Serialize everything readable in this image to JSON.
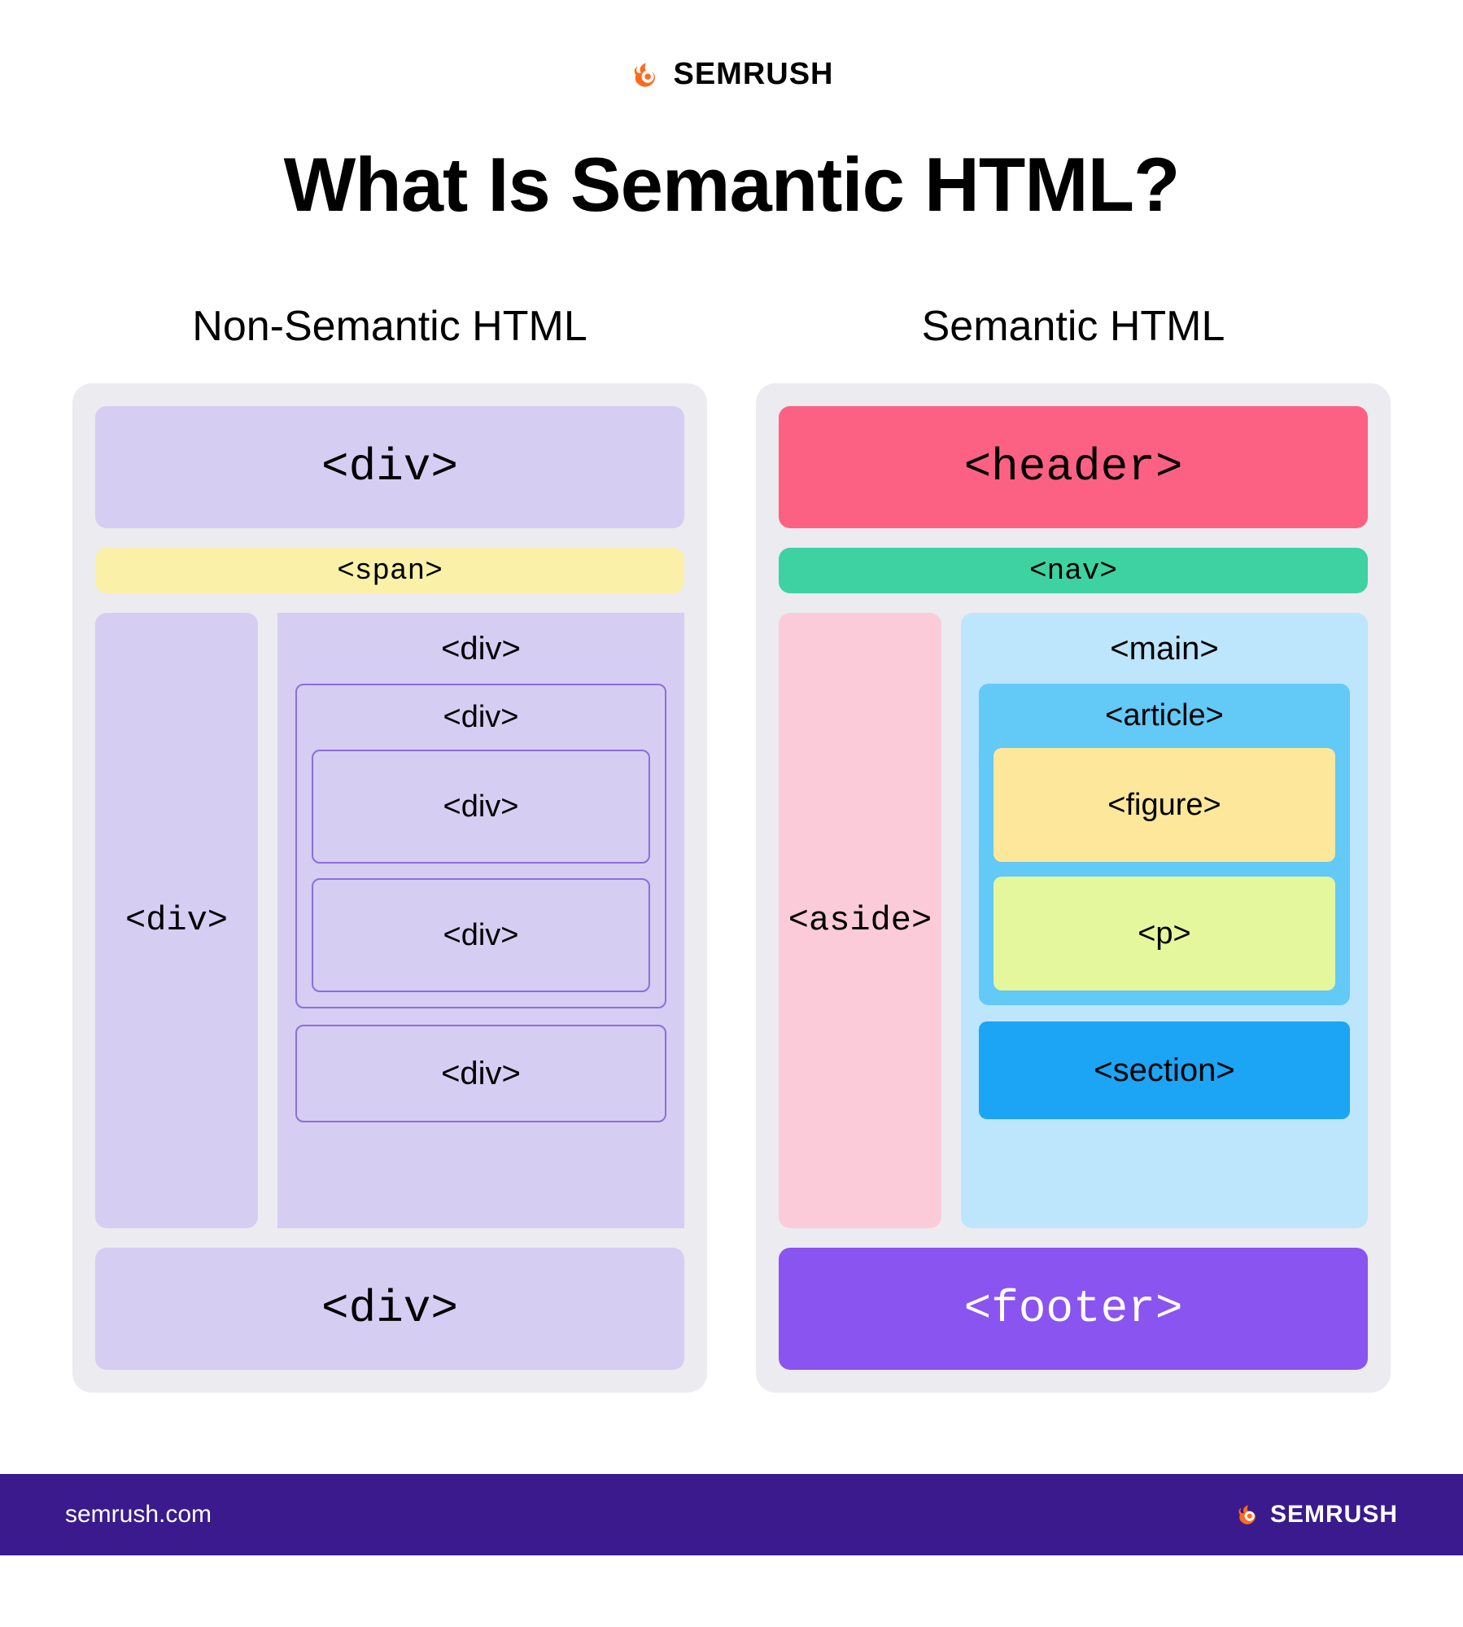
{
  "brand": {
    "name": "SEMRUSH",
    "url": "semrush.com"
  },
  "title": "What Is Semantic HTML?",
  "left": {
    "heading": "Non-Semantic HTML",
    "header": "<div>",
    "span": "<span>",
    "aside": "<div>",
    "main": "<div>",
    "inner": "<div>",
    "inner_a": "<div>",
    "inner_b": "<div>",
    "section": "<div>",
    "footer": "<div>"
  },
  "right": {
    "heading": "Semantic HTML",
    "header": "<header>",
    "nav": "<nav>",
    "aside": "<aside>",
    "main": "<main>",
    "article": "<article>",
    "figure": "<figure>",
    "p": "<p>",
    "section": "<section>",
    "footer": "<footer>"
  }
}
